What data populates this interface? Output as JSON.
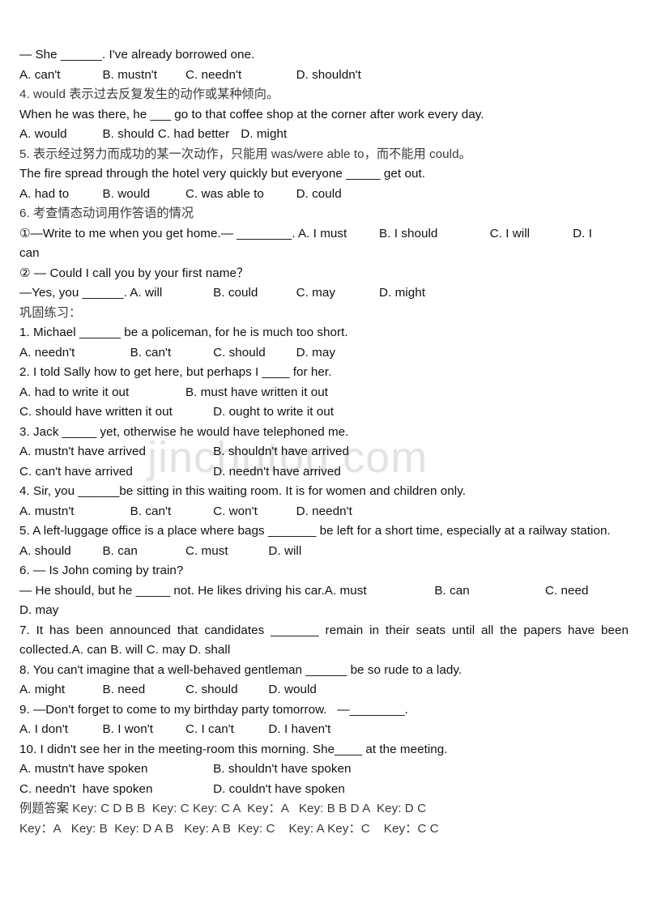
{
  "document": {
    "watermark": "jinchutou.com",
    "watermark_color": "#e3e3e6",
    "text_color": "#111111",
    "cjk_text_color": "#3a3a3a",
    "background_color": "#ffffff",
    "lines": [
      {
        "id": "l01",
        "text": "— She ______. I've already borrowed one.",
        "script": "latin"
      },
      {
        "id": "l02",
        "text": "A. can't\t\tB. mustn't\tC. needn't\t\tD. shouldn't",
        "script": "latin"
      },
      {
        "id": "l03",
        "text": "4. would 表示过去反复发生的动作或某种倾向。",
        "script": "cjk"
      },
      {
        "id": "l04",
        "text": "When he was there, he ___ go to that coffee shop at the corner after work every day.",
        "script": "latin"
      },
      {
        "id": "l05",
        "text": "A. would\t\tB. should\tC. had better\tD. might",
        "script": "latin"
      },
      {
        "id": "l06",
        "text": "5. 表示经过努力而成功的某一次动作，只能用 was/were able to，而不能用 could。",
        "script": "cjk"
      },
      {
        "id": "l07",
        "text": "The fire spread through the hotel very quickly but everyone _____ get out.",
        "script": "latin"
      },
      {
        "id": "l08",
        "text": "A. had to\t\tB. would\t\tC. was able to\t\tD. could",
        "script": "latin"
      },
      {
        "id": "l09",
        "text": "6. 考查情态动词用作答语的情况",
        "script": "cjk"
      },
      {
        "id": "l10",
        "text": "①—Write to me when you get home.— ________. A. I must\t\tB. I should\t\tC. I will\t\tD. I",
        "script": "latin"
      },
      {
        "id": "l11",
        "text": "can",
        "script": "latin"
      },
      {
        "id": "l12",
        "text": "② — Could I call you by your first name？",
        "script": "latin"
      },
      {
        "id": "l13",
        "text": "—Yes, you ______. A. will\t\tB. could\t\tC. may\t\tD. might",
        "script": "latin"
      },
      {
        "id": "l14",
        "text": "巩固练习：",
        "script": "cjk"
      },
      {
        "id": "l15",
        "text": "1. Michael ______ be a policeman, for he is much too short.",
        "script": "latin"
      },
      {
        "id": "l16",
        "text": "A. needn't\t\tB. can't\t\tC. should\t\tD. may",
        "script": "latin"
      },
      {
        "id": "l17",
        "text": "2. I told Sally how to get here, but perhaps I ____ for her.",
        "script": "latin"
      },
      {
        "id": "l18",
        "text": "A. had to write it out\t\tB. must have written it out",
        "script": "latin"
      },
      {
        "id": "l19",
        "text": "C. should have written it out\t\tD. ought to write it out",
        "script": "latin"
      },
      {
        "id": "l20",
        "text": "3. Jack _____ yet, otherwise he would have telephoned me.",
        "script": "latin"
      },
      {
        "id": "l21",
        "text": "A. mustn't have arrived\t\t\tB. shouldn't have arrived",
        "script": "latin"
      },
      {
        "id": "l22",
        "text": "C. can't have arrived\t\t\tD. needn't have arrived",
        "script": "latin"
      },
      {
        "id": "l23",
        "text": "4. Sir, you ______be sitting in this waiting room. It is for women and children only.",
        "script": "latin"
      },
      {
        "id": "l24",
        "text": "A. mustn't\t\tB. can't\t\tC. won't\t\tD. needn't",
        "script": "latin"
      },
      {
        "id": "l25",
        "text": "5. A left-luggage office is a place where bags _______ be left for a short time, especially at a railway station.",
        "script": "latin",
        "justify": true
      },
      {
        "id": "l26",
        "text": "A. should\t\tB. can\t\tC. must\t\tD. will",
        "script": "latin"
      },
      {
        "id": "l27",
        "text": "6. — Is John coming by train?",
        "script": "latin"
      },
      {
        "id": "l28",
        "text": "— He should, but he _____ not. He likes driving his car.A. must\t\t\tB. can\t\t\tC. need",
        "script": "latin"
      },
      {
        "id": "l29",
        "text": "D. may",
        "script": "latin"
      },
      {
        "id": "l30",
        "text": "7. It has been announced that candidates _______ remain in their seats until all the papers have been collected.A. can\t\t\tB. will\t\t\tC. may\t\t\tD. shall",
        "script": "latin",
        "justify": true
      },
      {
        "id": "l31",
        "text": "8. You can't imagine that a well-behaved gentleman ______ be so rude to a lady.",
        "script": "latin"
      },
      {
        "id": "l32",
        "text": "A. might\t\tB. need\t\tC. should\t\tD. would",
        "script": "latin"
      },
      {
        "id": "l33",
        "text": "9. —Don't forget to come to my birthday party tomorrow.   —________.",
        "script": "latin"
      },
      {
        "id": "l34",
        "text": "A. I don't\t\tB. I won't\t\tC. I can't\t\tD. I haven't",
        "script": "latin"
      },
      {
        "id": "l35",
        "text": "10. I didn't see her in the meeting-room this morning. She____ at the meeting.",
        "script": "latin"
      },
      {
        "id": "l36",
        "text": "A. mustn't have spoken\t\t\tB. shouldn't have spoken",
        "script": "latin"
      },
      {
        "id": "l37",
        "text": "C. needn't  have spoken\t\t\tD. couldn't have spoken",
        "script": "latin"
      },
      {
        "id": "l38",
        "text": "例题答案 Key: C D B B  Key: C Key: C A  Key：A   Key: B B D A  Key: D C",
        "script": "cjk"
      },
      {
        "id": "l39",
        "text": "Key：A   Key: B  Key: D A B   Key: A B  Key: C    Key: A Key：C    Key：C C",
        "script": "cjk"
      }
    ],
    "answer_keys": {
      "label": "例题答案",
      "groups": [
        "Key: C D B B",
        "Key: C",
        "Key: C A",
        "Key：A",
        "Key: B B D A",
        "Key: D C",
        "Key：A",
        "Key: B",
        "Key: D A B",
        "Key: A B",
        "Key: C",
        "Key: A",
        "Key：C",
        "Key：C C"
      ]
    }
  }
}
